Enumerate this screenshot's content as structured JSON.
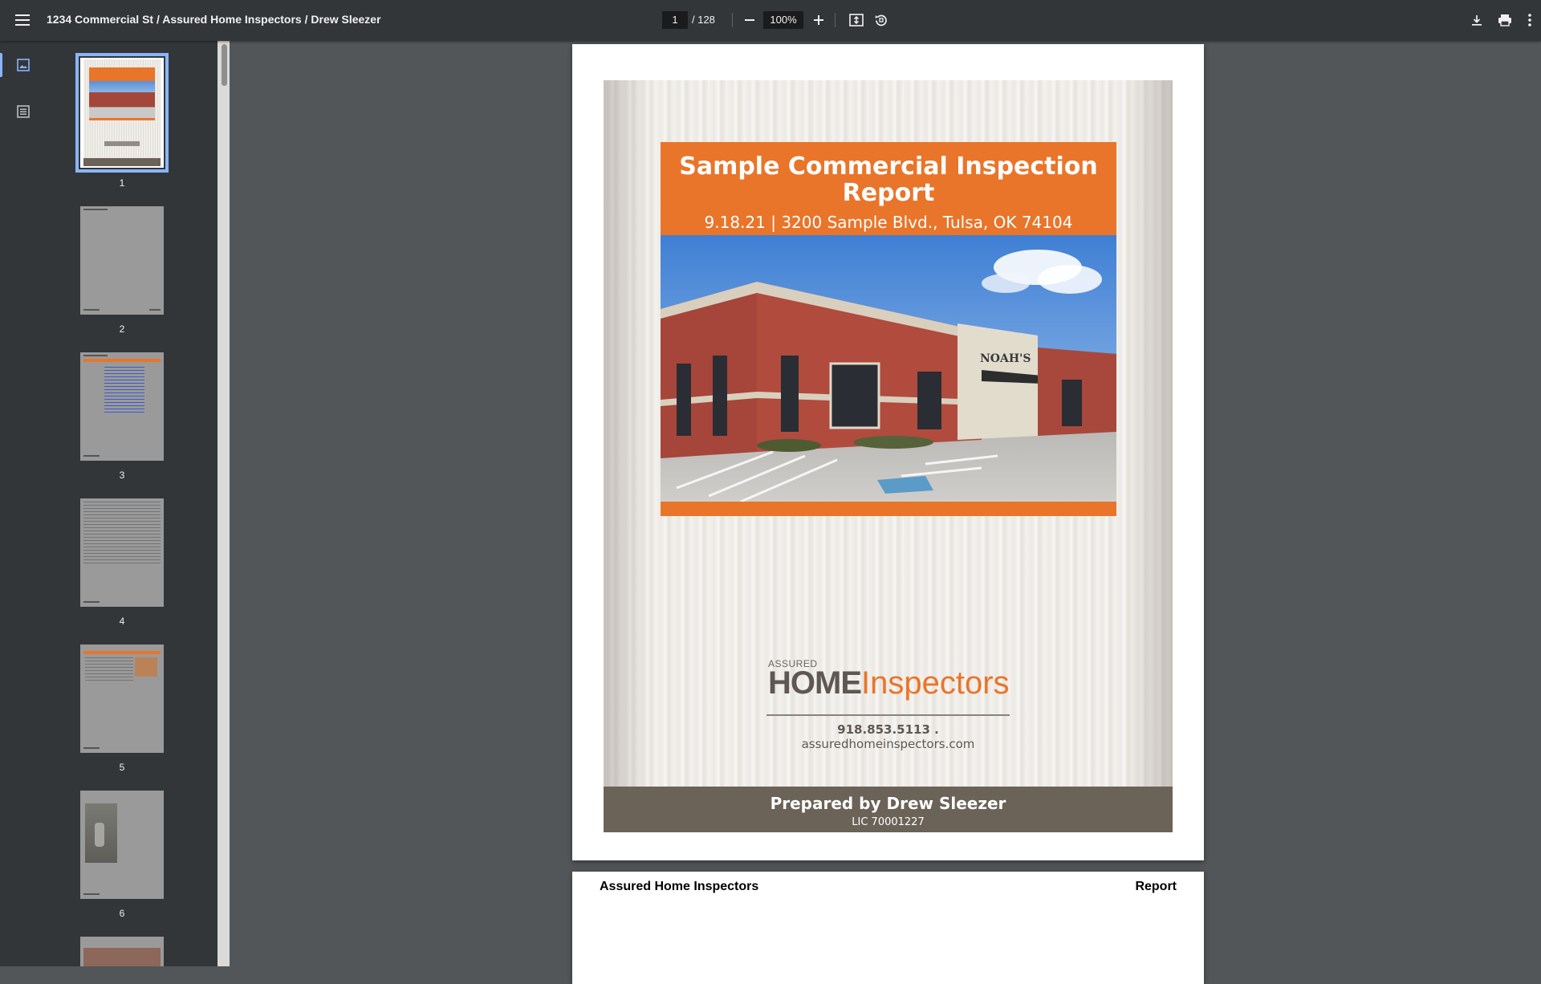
{
  "toolbar": {
    "title": "1234 Commercial St / Assured Home Inspectors / Drew Sleezer",
    "page_current": "1",
    "page_total": "/ 128",
    "zoom": "100%"
  },
  "thumbnails": [
    {
      "num": "1",
      "selected": true
    },
    {
      "num": "2"
    },
    {
      "num": "3"
    },
    {
      "num": "4"
    },
    {
      "num": "5"
    },
    {
      "num": "6"
    }
  ],
  "cover": {
    "title": "Sample Commercial Inspection Report",
    "subtitle": "9.18.21 | 3200 Sample Blvd., Tulsa, OK 74104",
    "building_sign": "NOAH'S",
    "logo_assured": "ASSURED",
    "logo_home": "HOME",
    "logo_inspectors": "Inspectors",
    "phone": "918.853.5113 .",
    "website": "assuredhomeinspectors.com",
    "prepared_by": "Prepared by Drew Sleezer",
    "license": "LIC 70001227"
  },
  "page2": {
    "header_left": "Assured Home Inspectors",
    "header_right": "Report"
  },
  "colors": {
    "accent_orange": "#e9752a",
    "band_brown": "#6b6258",
    "toolbar": "#323639",
    "viewer_bg": "#525659",
    "selection": "#8ab4f8"
  }
}
